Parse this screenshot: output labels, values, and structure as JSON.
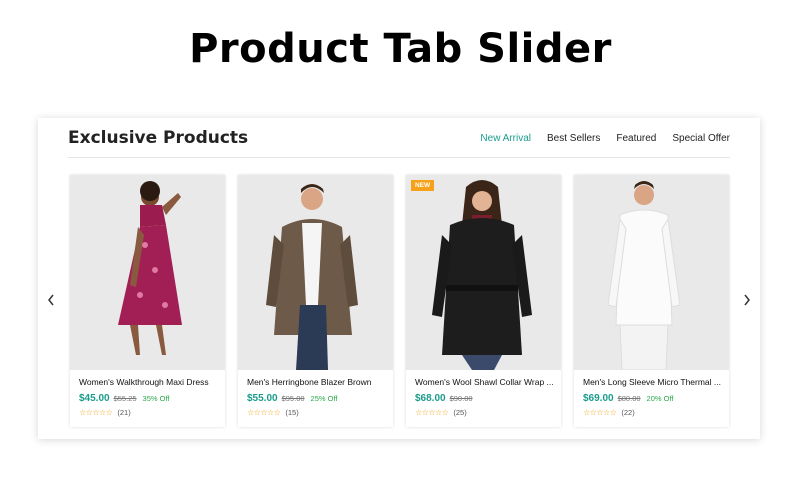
{
  "banner": {
    "title": "Product Tab Slider"
  },
  "widget": {
    "title": "Exclusive Products",
    "tabs": [
      {
        "label": "New Arrival",
        "active": true
      },
      {
        "label": "Best Sellers",
        "active": false
      },
      {
        "label": "Featured",
        "active": false
      },
      {
        "label": "Special Offer",
        "active": false
      }
    ]
  },
  "products": [
    {
      "name": "Women's Walkthrough Maxi Dress",
      "price": "$45.00",
      "old_price": "$55.25",
      "discount": "35% Off",
      "rating_icon": "star-outline-icon",
      "reviews": "(21)",
      "badge": ""
    },
    {
      "name": "Men's Herringbone Blazer Brown",
      "price": "$55.00",
      "old_price": "$95.00",
      "discount": "25% Off",
      "rating_icon": "star-outline-icon",
      "reviews": "(15)",
      "badge": ""
    },
    {
      "name": "Women's Wool Shawl Collar Wrap ...",
      "price": "$68.00",
      "old_price": "$90.00",
      "discount": "",
      "rating_icon": "star-outline-icon",
      "reviews": "(25)",
      "badge": "NEW"
    },
    {
      "name": "Men's Long Sleeve Micro Thermal ...",
      "price": "$69.00",
      "old_price": "$80.00",
      "discount": "20% Off",
      "rating_icon": "star-outline-icon",
      "reviews": "(22)",
      "badge": ""
    }
  ],
  "colors": {
    "accent": "#1a9c8c",
    "badge": "#f7a11a",
    "discount": "#2aa84a",
    "stars": "#f2a31b"
  }
}
